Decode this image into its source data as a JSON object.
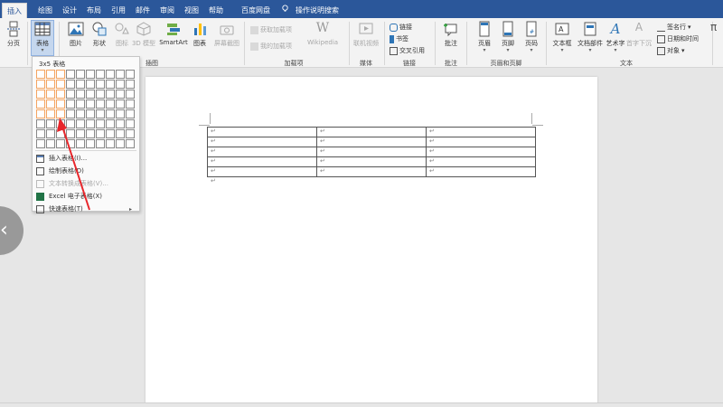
{
  "tabs": [
    {
      "label": "插入",
      "active": true
    },
    {
      "label": "绘图"
    },
    {
      "label": "设计"
    },
    {
      "label": "布局"
    },
    {
      "label": "引用"
    },
    {
      "label": "邮件"
    },
    {
      "label": "审阅"
    },
    {
      "label": "视图"
    },
    {
      "label": "帮助"
    },
    {
      "label": "百度网盘"
    }
  ],
  "tell_me": "操作说明搜索",
  "ribbon": {
    "fen_ye": "分页",
    "biao_ge": "表格",
    "tu_pian": "图片",
    "xing_zhuang": "形状",
    "tu_biao_icon": "图标",
    "mo_xing": "3D 模型",
    "smartart": "SmartArt",
    "tu_biao": "图表",
    "ping_mu_jie_tu": "屏幕截图",
    "huo_qu_jia_zai_xiang": "获取加载项",
    "wo_de_jia_zai_xiang": "我的加载项",
    "wikipedia": "Wikipedia",
    "lian_ji_shi_pin": "联机视频",
    "lian_jie": "链接",
    "shu_qian": "书签",
    "jiao_cha_yin_yong": "交叉引用",
    "pi_zhu": "批注",
    "ye_mei": "页眉",
    "ye_jiao": "页脚",
    "ye_ma": "页码",
    "wen_ben_kuang": "文本框",
    "wen_dang_bu_jian": "文档部件",
    "yi_shu_zi": "艺术字",
    "shou_zi_xia_chen": "首字下沉",
    "qian_ming_hang": "签名行",
    "ri_qi_he_shi_jian": "日期和时间",
    "dui_xiang": "对象",
    "groups": {
      "cha_tu": "插图",
      "jia_zai_xiang": "加载项",
      "mei_ti": "媒体",
      "lian_jie": "链接",
      "pi_zhu": "批注",
      "ye_mei_he_ye_jiao": "页眉和页脚",
      "wen_ben": "文本"
    }
  },
  "dropdown": {
    "title": "3x5 表格",
    "grid_rows": 8,
    "grid_cols": 10,
    "selected_rows": 5,
    "selected_cols": 3,
    "items": [
      {
        "label": "插入表格(I)...",
        "disabled": false
      },
      {
        "label": "绘制表格(D)",
        "disabled": false
      },
      {
        "label": "文本转换成表格(V)...",
        "disabled": true
      },
      {
        "label": "Excel 电子表格(X)",
        "disabled": false
      },
      {
        "label": "快速表格(T)",
        "disabled": false,
        "submenu": true
      }
    ]
  },
  "document": {
    "table_rows": 5,
    "table_cols": 3,
    "cell_mark": "↵",
    "para_mark": "↵"
  },
  "overlay": {
    "back_glyph": "‹"
  },
  "colors": {
    "accent": "#2b579a",
    "annotation_arrow": "#e8262b",
    "grid_highlight": "#f4a460"
  }
}
